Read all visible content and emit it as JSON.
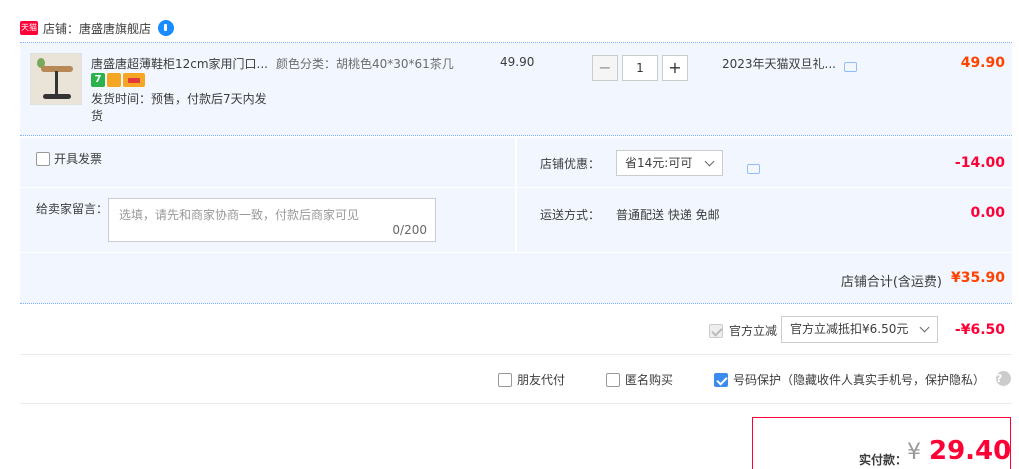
{
  "shop": {
    "logo_text": "天猫",
    "name": "店铺：唐盛唐旗舰店"
  },
  "item": {
    "title": "唐盛唐超薄鞋柜12cm家用门口...",
    "badges": [
      "7"
    ],
    "ship_time": "发货时间：预售，付款后7天内发货",
    "sku": "颜色分类：胡桃色40*30*61茶几",
    "unit_price": "49.90",
    "quantity": "1",
    "qty_minus": "−",
    "qty_plus": "+",
    "promotion": "2023年天猫双旦礼...",
    "total": "49.90"
  },
  "options": {
    "invoice_label": "开具发票",
    "message_label": "给卖家留言：",
    "message_placeholder": "选填，请先和商家协商一致，付款后商家可见",
    "message_count": "0/200",
    "discount_label": "店铺优惠：",
    "discount_selected": "省14元:可可",
    "discount_amount": "-14.00",
    "shipping_label": "运送方式：",
    "shipping_value": "普通配送 快递 免邮",
    "shipping_amount": "0.00"
  },
  "shop_total": {
    "label": "店铺合计(含运费)",
    "amount": "¥35.90"
  },
  "official": {
    "label": "官方立减",
    "selected": "官方立减抵扣¥6.50元",
    "amount": "-¥6.50"
  },
  "extras": {
    "friend_pay": "朋友代付",
    "anonymous": "匿名购买",
    "phone_protect": "号码保护（隐藏收件人真实手机号，保护隐私）",
    "help": "?"
  },
  "payment": {
    "label": "实付款：",
    "currency": "¥",
    "amount": "29.40"
  },
  "colors": {
    "accent_red": "#ff0036",
    "price_orange": "#ff4200",
    "panel_blue": "#f2f7ff",
    "check_blue": "#3c8cf0"
  }
}
